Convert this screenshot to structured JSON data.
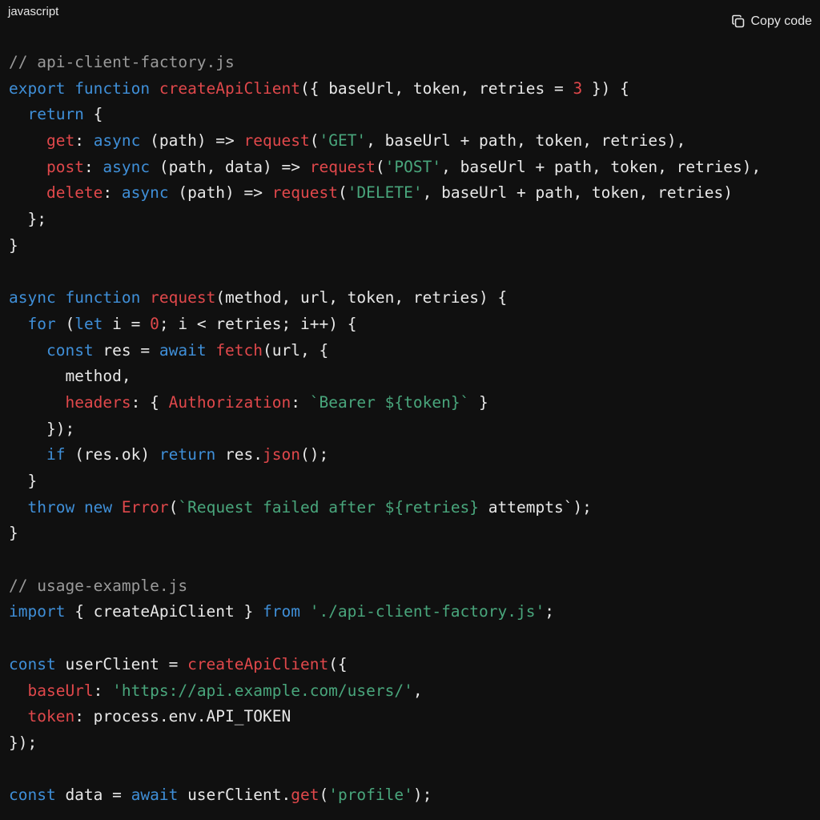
{
  "header": {
    "language": "javascript",
    "copy_label": "Copy code",
    "copy_icon": "copy-icon"
  },
  "colors": {
    "background": "#101010",
    "plain": "#e8e8e8",
    "comment": "#9a9a9a",
    "keyword": "#3f8fd8",
    "function": "#e0484b",
    "string": "#49a67c"
  },
  "code": {
    "lines": [
      [
        [
          "comment",
          "// api-client-factory.js"
        ]
      ],
      [
        [
          "keyword",
          "export "
        ],
        [
          "keyword",
          "function "
        ],
        [
          "func",
          "createApiClient"
        ],
        [
          "plain",
          "({ baseUrl, token, retries = "
        ],
        [
          "number",
          "3"
        ],
        [
          "plain",
          " }) {"
        ]
      ],
      [
        [
          "plain",
          "  "
        ],
        [
          "keyword",
          "return"
        ],
        [
          "plain",
          " {"
        ]
      ],
      [
        [
          "plain",
          "    "
        ],
        [
          "prop",
          "get"
        ],
        [
          "plain",
          ": "
        ],
        [
          "keyword",
          "async"
        ],
        [
          "plain",
          " (path) => "
        ],
        [
          "func",
          "request"
        ],
        [
          "plain",
          "("
        ],
        [
          "string",
          "'GET'"
        ],
        [
          "plain",
          ", baseUrl + path, token, retries),"
        ]
      ],
      [
        [
          "plain",
          "    "
        ],
        [
          "prop",
          "post"
        ],
        [
          "plain",
          ": "
        ],
        [
          "keyword",
          "async"
        ],
        [
          "plain",
          " (path, data) => "
        ],
        [
          "func",
          "request"
        ],
        [
          "plain",
          "("
        ],
        [
          "string",
          "'POST'"
        ],
        [
          "plain",
          ", baseUrl + path, token, retries),"
        ]
      ],
      [
        [
          "plain",
          "    "
        ],
        [
          "prop",
          "delete"
        ],
        [
          "plain",
          ": "
        ],
        [
          "keyword",
          "async"
        ],
        [
          "plain",
          " (path) => "
        ],
        [
          "func",
          "request"
        ],
        [
          "plain",
          "("
        ],
        [
          "string",
          "'DELETE'"
        ],
        [
          "plain",
          ", baseUrl + path, token, retries)"
        ]
      ],
      [
        [
          "plain",
          "  };"
        ]
      ],
      [
        [
          "plain",
          "}"
        ]
      ],
      [],
      [
        [
          "keyword",
          "async "
        ],
        [
          "keyword",
          "function "
        ],
        [
          "func",
          "request"
        ],
        [
          "plain",
          "(method, url, token, retries) {"
        ]
      ],
      [
        [
          "plain",
          "  "
        ],
        [
          "keyword",
          "for"
        ],
        [
          "plain",
          " ("
        ],
        [
          "keyword",
          "let"
        ],
        [
          "plain",
          " i = "
        ],
        [
          "number",
          "0"
        ],
        [
          "plain",
          "; i < retries; i++) {"
        ]
      ],
      [
        [
          "plain",
          "    "
        ],
        [
          "keyword",
          "const"
        ],
        [
          "plain",
          " res = "
        ],
        [
          "keyword",
          "await "
        ],
        [
          "func",
          "fetch"
        ],
        [
          "plain",
          "(url, {"
        ]
      ],
      [
        [
          "plain",
          "      method,"
        ]
      ],
      [
        [
          "plain",
          "      "
        ],
        [
          "prop",
          "headers"
        ],
        [
          "plain",
          ": { "
        ],
        [
          "prop",
          "Authorization"
        ],
        [
          "plain",
          ": "
        ],
        [
          "string",
          "`Bearer ${token}`"
        ],
        [
          "plain",
          " }"
        ]
      ],
      [
        [
          "plain",
          "    });"
        ]
      ],
      [
        [
          "plain",
          "    "
        ],
        [
          "keyword",
          "if"
        ],
        [
          "plain",
          " (res.ok) "
        ],
        [
          "keyword",
          "return"
        ],
        [
          "plain",
          " res."
        ],
        [
          "func",
          "json"
        ],
        [
          "plain",
          "();"
        ]
      ],
      [
        [
          "plain",
          "  }"
        ]
      ],
      [
        [
          "plain",
          "  "
        ],
        [
          "keyword",
          "throw "
        ],
        [
          "keyword",
          "new "
        ],
        [
          "func",
          "Error"
        ],
        [
          "plain",
          "("
        ],
        [
          "string",
          "`Request failed after ${retries}"
        ],
        [
          "plain",
          " attempts`);"
        ]
      ],
      [
        [
          "plain",
          "}"
        ]
      ],
      [],
      [
        [
          "comment",
          "// usage-example.js"
        ]
      ],
      [
        [
          "keyword",
          "import"
        ],
        [
          "plain",
          " { createApiClient } "
        ],
        [
          "keyword",
          "from "
        ],
        [
          "string",
          "'./api-client-factory.js'"
        ],
        [
          "plain",
          ";"
        ]
      ],
      [],
      [
        [
          "keyword",
          "const"
        ],
        [
          "plain",
          " userClient = "
        ],
        [
          "func",
          "createApiClient"
        ],
        [
          "plain",
          "({"
        ]
      ],
      [
        [
          "plain",
          "  "
        ],
        [
          "prop",
          "baseUrl"
        ],
        [
          "plain",
          ": "
        ],
        [
          "string",
          "'https://api.example.com/users/'"
        ],
        [
          "plain",
          ","
        ]
      ],
      [
        [
          "plain",
          "  "
        ],
        [
          "prop",
          "token"
        ],
        [
          "plain",
          ": process.env.API_TOKEN"
        ]
      ],
      [
        [
          "plain",
          "});"
        ]
      ],
      [],
      [
        [
          "keyword",
          "const"
        ],
        [
          "plain",
          " data = "
        ],
        [
          "keyword",
          "await"
        ],
        [
          "plain",
          " userClient."
        ],
        [
          "func",
          "get"
        ],
        [
          "plain",
          "("
        ],
        [
          "string",
          "'profile'"
        ],
        [
          "plain",
          ");"
        ]
      ]
    ]
  }
}
